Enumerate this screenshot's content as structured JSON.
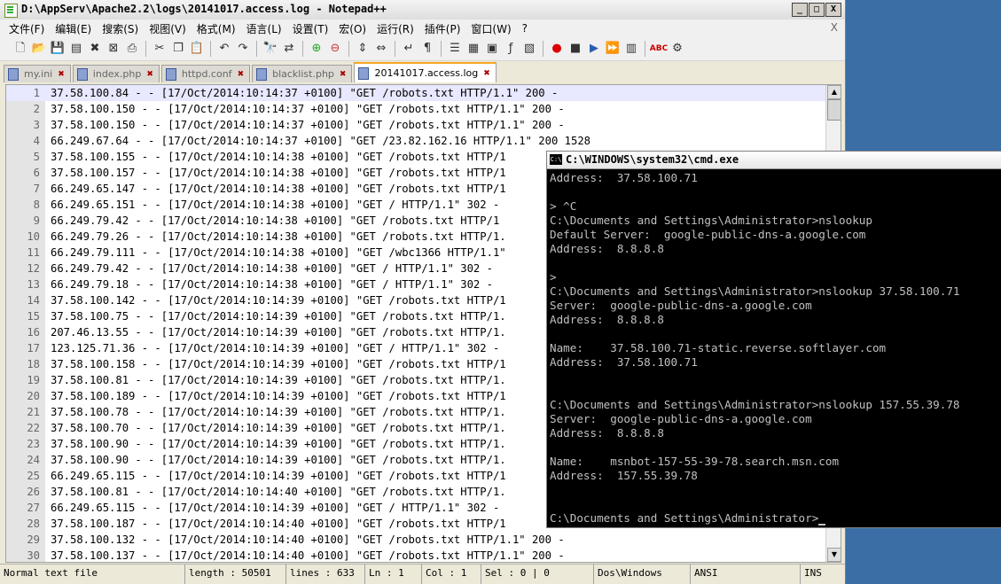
{
  "notepad": {
    "title": "D:\\AppServ\\Apache2.2\\logs\\20141017.access.log - Notepad++",
    "window_buttons": [
      "_",
      "□",
      "X"
    ],
    "menu": [
      "文件(F)",
      "编辑(E)",
      "搜索(S)",
      "视图(V)",
      "格式(M)",
      "语言(L)",
      "设置(T)",
      "宏(O)",
      "运行(R)",
      "插件(P)",
      "窗口(W)",
      "?"
    ],
    "menu_close": "X",
    "tabs": [
      {
        "label": "my.ini",
        "active": false
      },
      {
        "label": "index.php",
        "active": false
      },
      {
        "label": "httpd.conf",
        "active": false
      },
      {
        "label": "blacklist.php",
        "active": false
      },
      {
        "label": "20141017.access.log",
        "active": true
      }
    ],
    "lines": [
      {
        "n": "1",
        "text": "37.58.100.84 - - [17/Oct/2014:10:14:37 +0100] \"GET /robots.txt HTTP/1.1\" 200 -"
      },
      {
        "n": "2",
        "text": "37.58.100.150 - - [17/Oct/2014:10:14:37 +0100] \"GET /robots.txt HTTP/1.1\" 200 -"
      },
      {
        "n": "3",
        "text": "37.58.100.150 - - [17/Oct/2014:10:14:37 +0100] \"GET /robots.txt HTTP/1.1\" 200 -"
      },
      {
        "n": "4",
        "text": "66.249.67.64 - - [17/Oct/2014:10:14:37 +0100] \"GET /23.82.162.16 HTTP/1.1\" 200 1528"
      },
      {
        "n": "5",
        "text": "37.58.100.155 - - [17/Oct/2014:10:14:38 +0100] \"GET /robots.txt HTTP/1"
      },
      {
        "n": "6",
        "text": "37.58.100.157 - - [17/Oct/2014:10:14:38 +0100] \"GET /robots.txt HTTP/1"
      },
      {
        "n": "7",
        "text": "66.249.65.147 - - [17/Oct/2014:10:14:38 +0100] \"GET /robots.txt HTTP/1"
      },
      {
        "n": "8",
        "text": "66.249.65.151 - - [17/Oct/2014:10:14:38 +0100] \"GET / HTTP/1.1\" 302 -"
      },
      {
        "n": "9",
        "text": "66.249.79.42 - - [17/Oct/2014:10:14:38 +0100] \"GET /robots.txt HTTP/1"
      },
      {
        "n": "10",
        "text": "66.249.79.26 - - [17/Oct/2014:10:14:38 +0100] \"GET /robots.txt HTTP/1."
      },
      {
        "n": "11",
        "text": "66.249.79.111 - - [17/Oct/2014:10:14:38 +0100] \"GET /wbc1366 HTTP/1.1\""
      },
      {
        "n": "12",
        "text": "66.249.79.42 - - [17/Oct/2014:10:14:38 +0100] \"GET / HTTP/1.1\" 302 -"
      },
      {
        "n": "13",
        "text": "66.249.79.18 - - [17/Oct/2014:10:14:38 +0100] \"GET / HTTP/1.1\" 302 -"
      },
      {
        "n": "14",
        "text": "37.58.100.142 - - [17/Oct/2014:10:14:39 +0100] \"GET /robots.txt HTTP/1"
      },
      {
        "n": "15",
        "text": "37.58.100.75 - - [17/Oct/2014:10:14:39 +0100] \"GET /robots.txt HTTP/1."
      },
      {
        "n": "16",
        "text": "207.46.13.55 - - [17/Oct/2014:10:14:39 +0100] \"GET /robots.txt HTTP/1."
      },
      {
        "n": "17",
        "text": "123.125.71.36 - - [17/Oct/2014:10:14:39 +0100] \"GET / HTTP/1.1\" 302 -"
      },
      {
        "n": "18",
        "text": "37.58.100.158 - - [17/Oct/2014:10:14:39 +0100] \"GET /robots.txt HTTP/1"
      },
      {
        "n": "19",
        "text": "37.58.100.81 - - [17/Oct/2014:10:14:39 +0100] \"GET /robots.txt HTTP/1."
      },
      {
        "n": "20",
        "text": "37.58.100.189 - - [17/Oct/2014:10:14:39 +0100] \"GET /robots.txt HTTP/1"
      },
      {
        "n": "21",
        "text": "37.58.100.78 - - [17/Oct/2014:10:14:39 +0100] \"GET /robots.txt HTTP/1."
      },
      {
        "n": "22",
        "text": "37.58.100.70 - - [17/Oct/2014:10:14:39 +0100] \"GET /robots.txt HTTP/1."
      },
      {
        "n": "23",
        "text": "37.58.100.90 - - [17/Oct/2014:10:14:39 +0100] \"GET /robots.txt HTTP/1."
      },
      {
        "n": "24",
        "text": "37.58.100.90 - - [17/Oct/2014:10:14:39 +0100] \"GET /robots.txt HTTP/1."
      },
      {
        "n": "25",
        "text": "66.249.65.115 - - [17/Oct/2014:10:14:39 +0100] \"GET /robots.txt HTTP/1"
      },
      {
        "n": "26",
        "text": "37.58.100.81 - - [17/Oct/2014:10:14:40 +0100] \"GET /robots.txt HTTP/1."
      },
      {
        "n": "27",
        "text": "66.249.65.115 - - [17/Oct/2014:10:14:39 +0100] \"GET / HTTP/1.1\" 302 -"
      },
      {
        "n": "28",
        "text": "37.58.100.187 - - [17/Oct/2014:10:14:40 +0100] \"GET /robots.txt HTTP/1"
      },
      {
        "n": "29",
        "text": "37.58.100.132 - - [17/Oct/2014:10:14:40 +0100] \"GET /robots.txt HTTP/1.1\" 200 -"
      },
      {
        "n": "30",
        "text": "37.58.100.137 - - [17/Oct/2014:10:14:40 +0100] \"GET /robots.txt HTTP/1.1\" 200 -"
      }
    ],
    "status": {
      "type": "Normal text file",
      "length": "length : 50501",
      "lines": "lines : 633",
      "ln": "Ln : 1",
      "col": "Col : 1",
      "sel": "Sel : 0 | 0",
      "eol": "Dos\\Windows",
      "encoding": "ANSI",
      "mode": "INS"
    }
  },
  "cmd": {
    "icon_text": "C:\\",
    "title": "C:\\WINDOWS\\system32\\cmd.exe",
    "lines": [
      "Address:  37.58.100.71",
      "",
      "> ^C",
      "C:\\Documents and Settings\\Administrator>nslookup",
      "Default Server:  google-public-dns-a.google.com",
      "Address:  8.8.8.8",
      "",
      ">",
      "C:\\Documents and Settings\\Administrator>nslookup 37.58.100.71",
      "Server:  google-public-dns-a.google.com",
      "Address:  8.8.8.8",
      "",
      "Name:    37.58.100.71-static.reverse.softlayer.com",
      "Address:  37.58.100.71",
      "",
      "",
      "C:\\Documents and Settings\\Administrator>nslookup 157.55.39.78",
      "Server:  google-public-dns-a.google.com",
      "Address:  8.8.8.8",
      "",
      "Name:    msnbot-157-55-39-78.search.msn.com",
      "Address:  157.55.39.78",
      "",
      "",
      "C:\\Documents and Settings\\Administrator>"
    ]
  }
}
